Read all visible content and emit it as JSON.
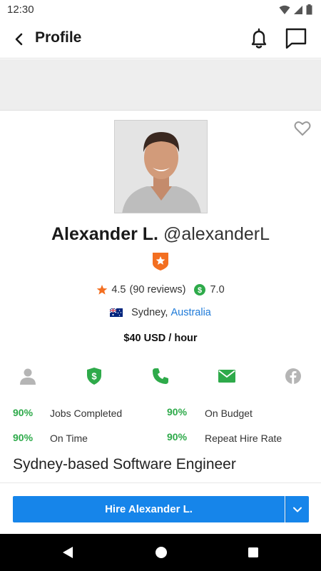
{
  "status_bar": {
    "time": "12:30",
    "icons": [
      "wifi-icon",
      "signal-icon",
      "battery-icon"
    ]
  },
  "app_bar": {
    "title": "Profile",
    "icons": [
      "back-arrow-icon",
      "bell-icon",
      "chat-icon"
    ]
  },
  "profile": {
    "name": "Alexander L.",
    "handle": "@alexanderL",
    "badge_icon": "preferred-freelancer-badge-icon",
    "rating": "4.5",
    "reviews": "(90 reviews)",
    "earnings_score": "7.0",
    "city": "Sydney,",
    "country": "Australia",
    "hourly_rate": "$40 USD / hour",
    "tagline": "Sydney-based Software Engineer"
  },
  "verifications": [
    {
      "icon": "user-verified-icon",
      "verified": false
    },
    {
      "icon": "payment-verified-icon",
      "verified": true
    },
    {
      "icon": "phone-verified-icon",
      "verified": true
    },
    {
      "icon": "email-verified-icon",
      "verified": true
    },
    {
      "icon": "facebook-icon",
      "verified": false
    }
  ],
  "stats": [
    {
      "pct": "90%",
      "label": "Jobs Completed"
    },
    {
      "pct": "90%",
      "label": "On Budget"
    },
    {
      "pct": "90%",
      "label": "On Time"
    },
    {
      "pct": "90%",
      "label": "Repeat Hire Rate"
    }
  ],
  "hire": {
    "button_label": "Hire Alexander L."
  },
  "colors": {
    "primary": "#1685ea",
    "success": "#2eaa4a",
    "badge": "#f36f21",
    "link": "#1e7ad8"
  }
}
